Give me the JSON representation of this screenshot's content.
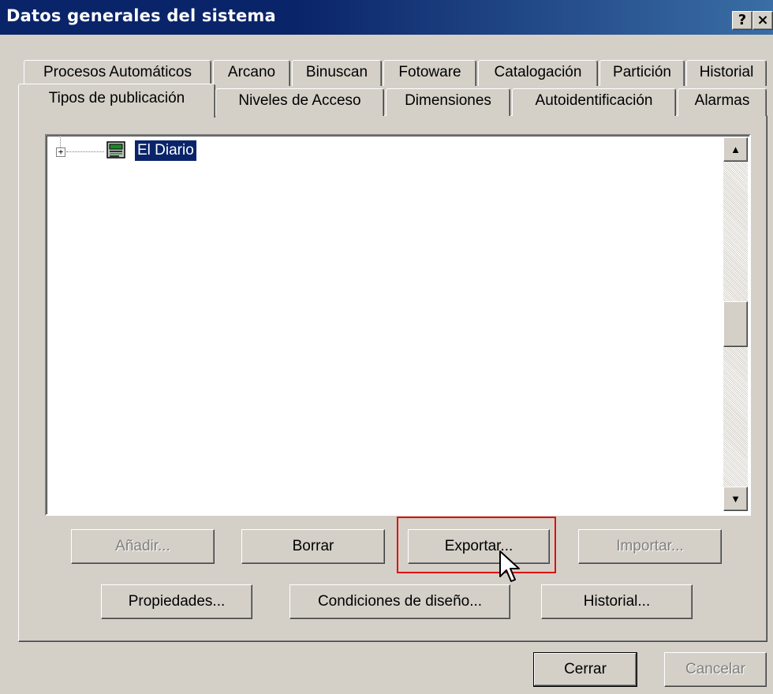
{
  "window": {
    "title": "Datos generales del sistema",
    "help_label": "?",
    "close_label": "×"
  },
  "tabs": {
    "row1": [
      {
        "label": "Procesos Automáticos"
      },
      {
        "label": "Arcano"
      },
      {
        "label": "Binuscan"
      },
      {
        "label": "Fotoware"
      },
      {
        "label": "Catalogación"
      },
      {
        "label": "Partición"
      },
      {
        "label": "Historial"
      }
    ],
    "row2": [
      {
        "label": "Tipos de publicación",
        "active": true
      },
      {
        "label": "Niveles de Acceso"
      },
      {
        "label": "Dimensiones"
      },
      {
        "label": "Autoidentificación"
      },
      {
        "label": "Alarmas"
      }
    ]
  },
  "tree": {
    "items": [
      {
        "label": "El Diario",
        "expander": "+",
        "selected": true
      }
    ]
  },
  "scrollbar": {
    "up_arrow": "▲",
    "down_arrow": "▼"
  },
  "buttons": {
    "anadir": "Añadir...",
    "borrar": "Borrar",
    "exportar": "Exportar...",
    "importar": "Importar...",
    "propiedades": "Propiedades...",
    "condiciones": "Condiciones de diseño...",
    "historial": "Historial..."
  },
  "footer": {
    "cerrar": "Cerrar",
    "cancelar": "Cancelar"
  },
  "colors": {
    "title_bar": "#0a246a",
    "selection": "#0a246a",
    "highlight_box": "#e01010",
    "face": "#d4d0c8"
  }
}
